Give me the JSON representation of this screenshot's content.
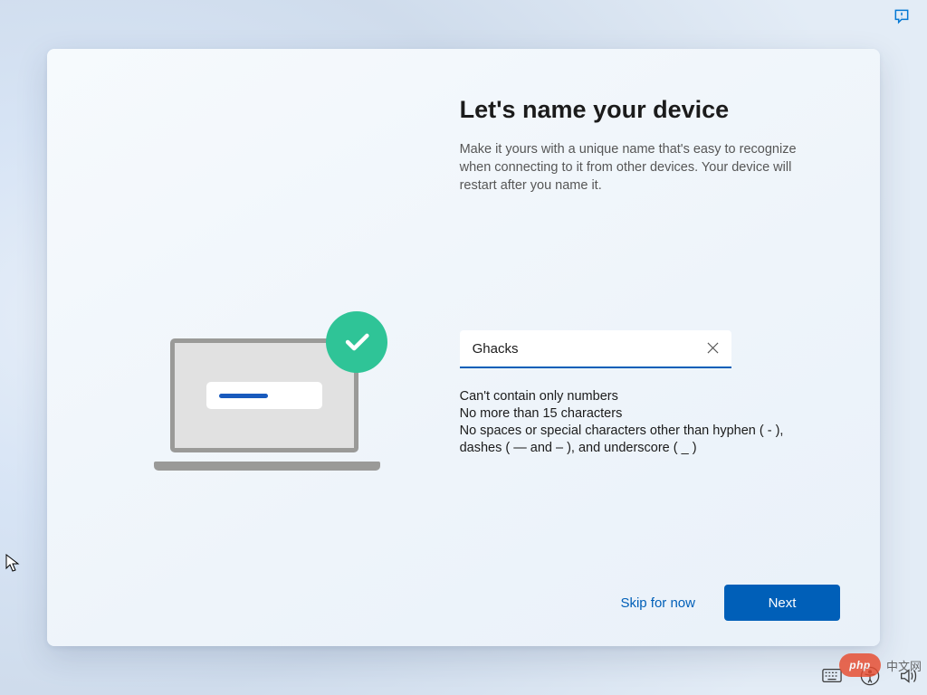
{
  "main": {
    "heading": "Let's name your device",
    "description": "Make it yours with a unique name that's easy to recognize when connecting to it from other devices. Your device will restart after you name it."
  },
  "input": {
    "value": "Ghacks",
    "placeholder": ""
  },
  "rules": {
    "line1": "Can't contain only numbers",
    "line2": "No more than 15 characters",
    "line3": "No spaces or special characters other than hyphen ( - ), dashes ( — and – ), and underscore ( _ )"
  },
  "buttons": {
    "skip": "Skip for now",
    "next": "Next"
  },
  "watermark": {
    "badge": "php",
    "text": "中文网"
  },
  "colors": {
    "accent": "#005fb8",
    "success": "#2fc497",
    "watermark": "#e84b2e"
  }
}
